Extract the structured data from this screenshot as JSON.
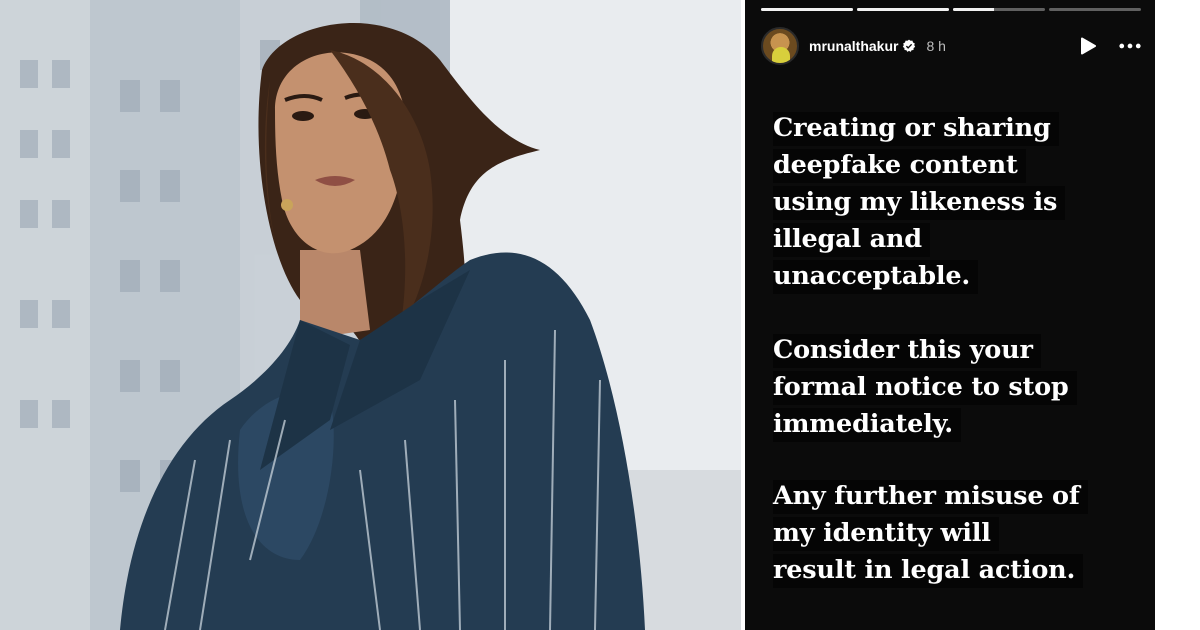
{
  "story": {
    "username": "mrunalthakur",
    "time": "8 h",
    "progress": [
      1,
      1,
      0.45,
      0
    ],
    "messages": [
      {
        "lines": [
          "Creating or sharing",
          "deepfake content",
          "using my likeness is",
          "illegal and",
          "unacceptable."
        ]
      },
      {
        "lines": [
          "Consider this your",
          "formal notice to stop",
          "immediately."
        ]
      },
      {
        "lines": [
          "Any further misuse of",
          "my identity will",
          "result in legal action."
        ]
      }
    ]
  },
  "icons": {
    "verified": "verified-badge-icon",
    "play": "play-icon",
    "more": "more-options-icon"
  },
  "colors": {
    "story_background": "#0b0b0b",
    "text": "#ffffff",
    "verified": "#ffffff",
    "jacket": "#243c52"
  }
}
